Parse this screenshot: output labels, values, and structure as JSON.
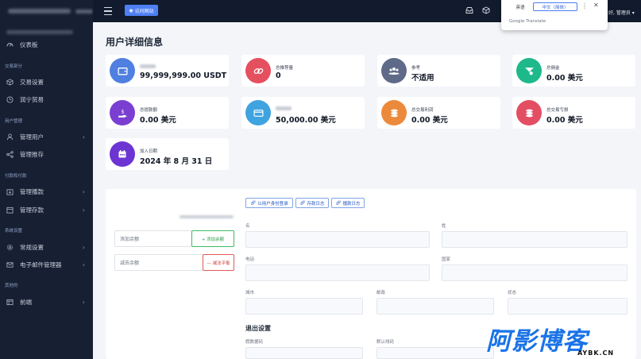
{
  "sidebar": {
    "items": [
      {
        "label": "仪表板",
        "icon": "dashboard-icon"
      },
      {
        "label": "交易设置",
        "icon": "cube-icon"
      },
      {
        "label": "润宁贸易",
        "icon": "clock-icon"
      },
      {
        "label": "管理用户",
        "icon": "user-icon"
      },
      {
        "label": "管理推存",
        "icon": "share-icon"
      },
      {
        "label": "管理播款",
        "icon": "download-icon"
      },
      {
        "label": "管理存款",
        "icon": "calendar-icon"
      },
      {
        "label": "常规设置",
        "icon": "gear-icon"
      },
      {
        "label": "电子邮件管理器",
        "icon": "mail-icon"
      },
      {
        "label": "前端",
        "icon": "window-icon"
      }
    ],
    "sections": [
      "交易部分",
      "用户管理",
      "付款和付款",
      "系统设置",
      "其他的"
    ]
  },
  "topbar": {
    "visit_label": "访问网站",
    "greeting": "好, 管理员"
  },
  "translate": {
    "lang_en": "英语",
    "lang_zh": "中文（简体）",
    "footer": "Google Translate"
  },
  "page": {
    "title": "用户详细信息"
  },
  "stats": [
    {
      "label": "",
      "value": "99,999,999.00 USDT",
      "icon": "wallet-icon",
      "color": "#4f7fe0"
    },
    {
      "label": "总推荐量",
      "value": "0",
      "icon": "link-icon",
      "color": "#e5505f"
    },
    {
      "label": "参考",
      "value": "不适用",
      "icon": "users-icon",
      "color": "#5e6a87"
    },
    {
      "label": "总佣金",
      "value": "0.00 美元",
      "icon": "coin-icon",
      "color": "#1db98b"
    },
    {
      "label": "总提款额",
      "value": "0.00 美元",
      "icon": "hand-money-icon",
      "color": "#7a3fd1"
    },
    {
      "label": "",
      "value": "50,000.00 美元",
      "icon": "card-icon",
      "color": "#3fa3e0"
    },
    {
      "label": "总交易利润",
      "value": "0.00 美元",
      "icon": "coins-icon",
      "color": "#ec8a3c"
    },
    {
      "label": "总交易亏损",
      "value": "0.00 美元",
      "icon": "coins-loss-icon",
      "color": "#e44e63"
    },
    {
      "label": "加入日期",
      "value": "2024 年 8 月 31 日",
      "icon": "calendar-icon",
      "color": "#6c35d3"
    }
  ],
  "actions": {
    "login_as": "以用户身份登录",
    "deposit_log": "存款日志",
    "withdraw_log": "播款日志"
  },
  "balance": {
    "add_placeholder": "添加余额",
    "add_button": "+ 添加余额",
    "sub_placeholder": "减去余额",
    "sub_button": "— 减法平衡"
  },
  "fields": {
    "first_name": "名",
    "last_name": "姓",
    "phone": "电话",
    "country": "国家",
    "city": "城市",
    "zip": "邮政",
    "state": "状态"
  },
  "exit": {
    "title": "退出设置",
    "label1": "假数据码",
    "label2": "默认线码"
  },
  "watermark": {
    "text": "阿影博客",
    "sub": "AYBK.CN"
  }
}
